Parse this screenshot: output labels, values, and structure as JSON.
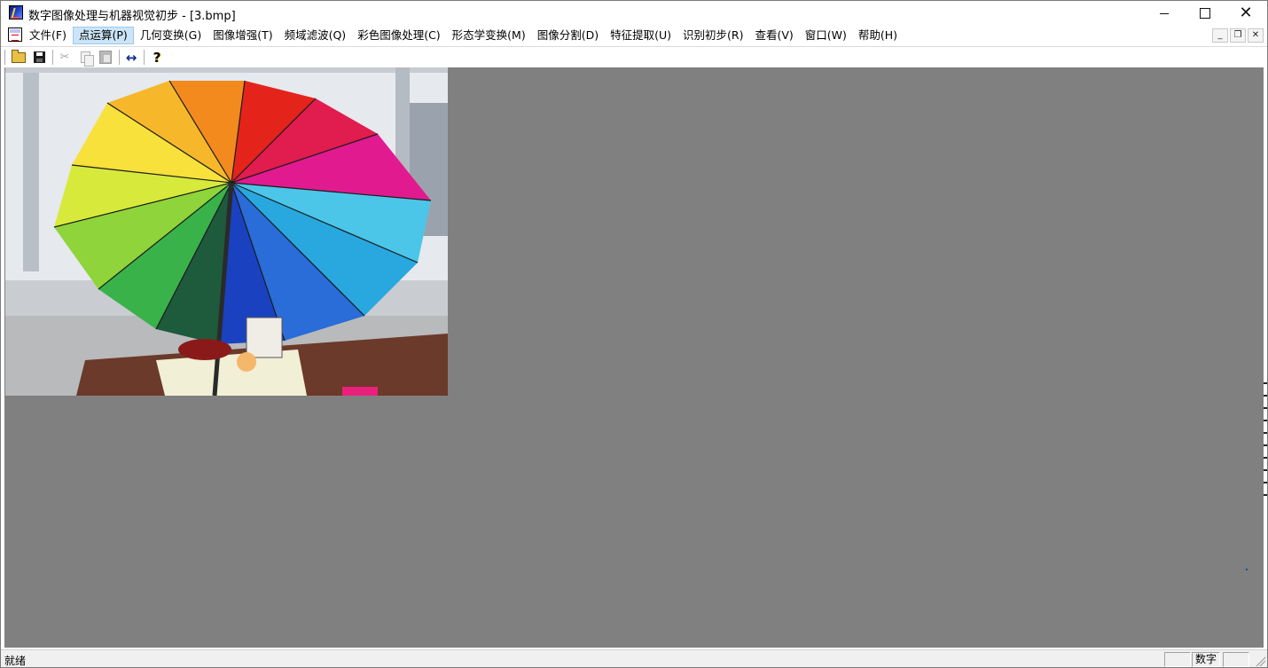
{
  "window": {
    "title": "数字图像处理与机器视觉初步 - [3.bmp]"
  },
  "menu": {
    "items": [
      "文件(F)",
      "点运算(P)",
      "几何变换(G)",
      "图像增强(T)",
      "频域滤波(Q)",
      "彩色图像处理(C)",
      "形态学变换(M)",
      "图像分割(D)",
      "特征提取(U)",
      "识别初步(R)",
      "查看(V)",
      "窗口(W)",
      "帮助(H)"
    ],
    "active_index": 1
  },
  "toolbar": {
    "buttons": [
      "open-icon",
      "save-icon",
      "cut-icon",
      "copy-icon",
      "paste-icon",
      "swap-arrows-icon",
      "help-icon"
    ]
  },
  "document": {
    "image_subject": "rainbow umbrella by window"
  },
  "status": {
    "text": "就绪",
    "pane_num": "数字"
  },
  "colors": {
    "client_bg": "#808080",
    "menu_highlight": "#cce4f7"
  }
}
